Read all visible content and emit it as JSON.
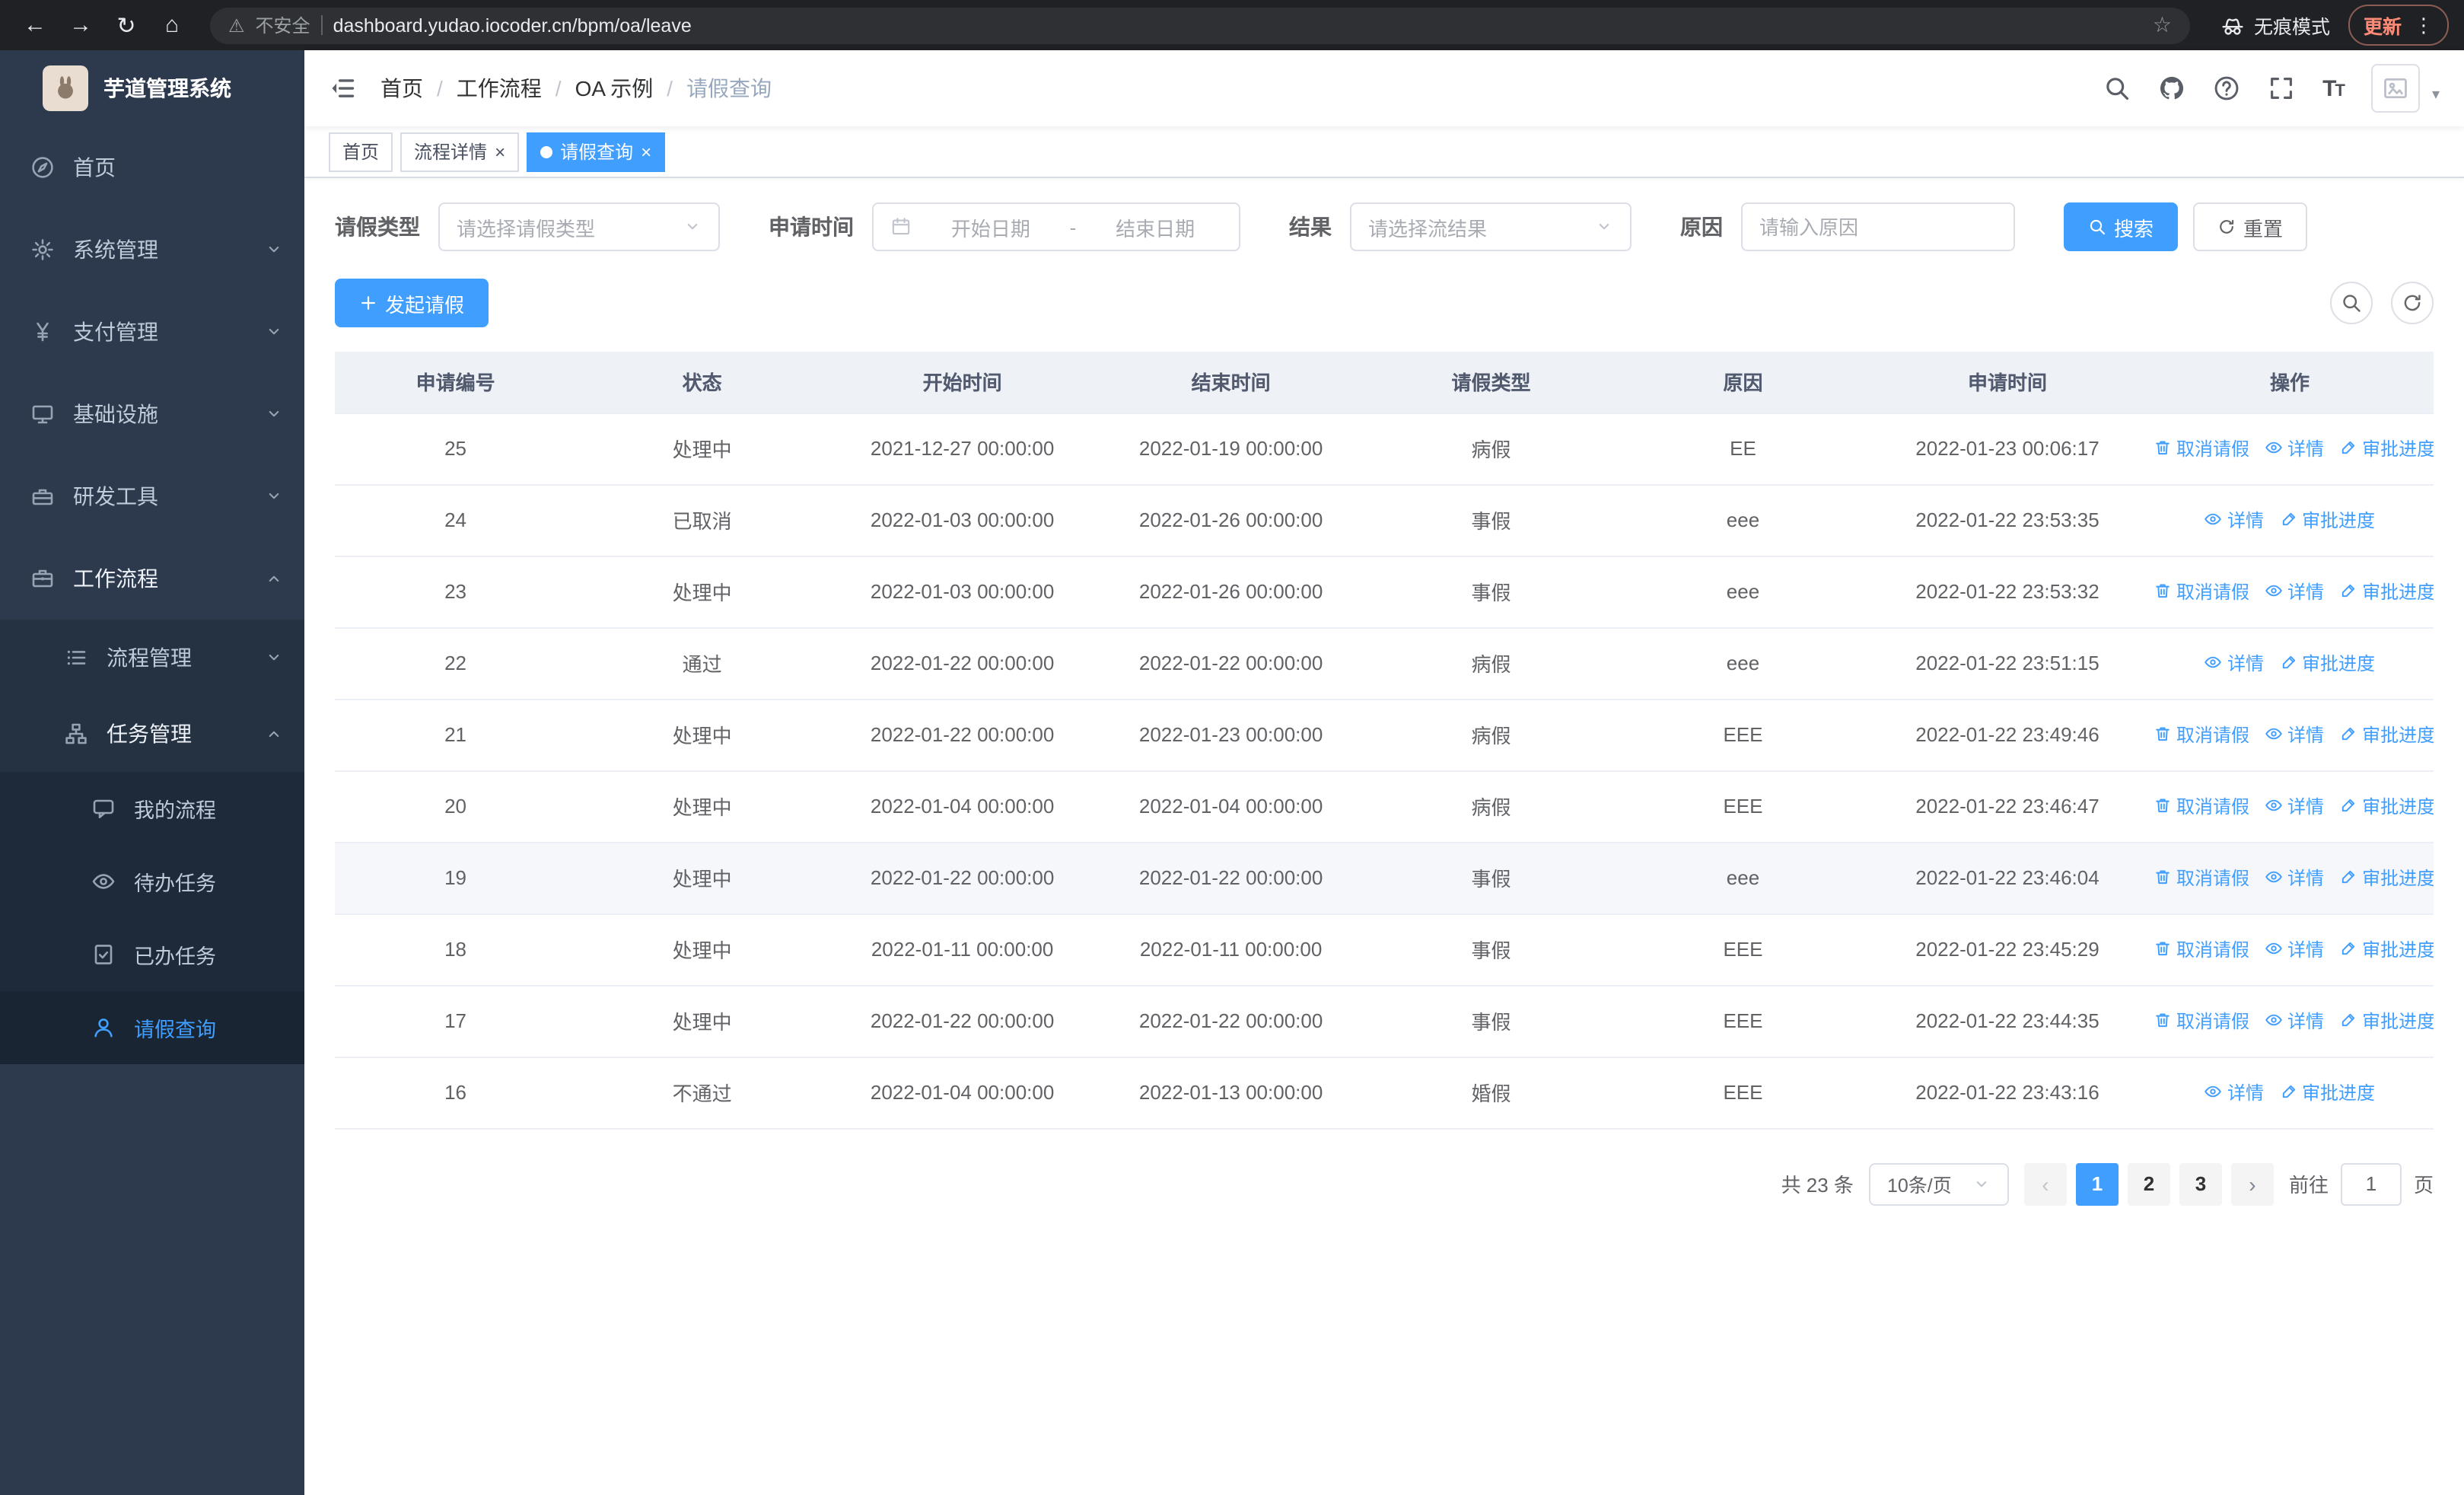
{
  "browser": {
    "security_label": "不安全",
    "url": "dashboard.yudao.iocoder.cn/bpm/oa/leave",
    "incognito_label": "无痕模式",
    "update_label": "更新"
  },
  "sidebar": {
    "logo_title": "芋道管理系统",
    "items": [
      {
        "label": "首页",
        "icon": "compass-icon"
      },
      {
        "label": "系统管理",
        "icon": "gear-icon"
      },
      {
        "label": "支付管理",
        "icon": "yen-icon"
      },
      {
        "label": "基础设施",
        "icon": "monitor-icon"
      },
      {
        "label": "研发工具",
        "icon": "toolbox-icon"
      },
      {
        "label": "工作流程",
        "icon": "briefcase-icon"
      }
    ],
    "workflow_children": [
      {
        "label": "流程管理",
        "icon": "list-icon"
      },
      {
        "label": "任务管理",
        "icon": "hierarchy-icon"
      }
    ],
    "task_children": [
      {
        "label": "我的流程",
        "icon": "chat-icon"
      },
      {
        "label": "待办任务",
        "icon": "eye-icon"
      },
      {
        "label": "已办任务",
        "icon": "doc-check-icon"
      },
      {
        "label": "请假查询",
        "icon": "user-icon"
      }
    ]
  },
  "header": {
    "breadcrumb": [
      "首页",
      "工作流程",
      "OA 示例",
      "请假查询"
    ]
  },
  "tabs": [
    {
      "label": "首页",
      "closable": false,
      "active": false
    },
    {
      "label": "流程详情",
      "closable": true,
      "active": false
    },
    {
      "label": "请假查询",
      "closable": true,
      "active": true
    }
  ],
  "filters": {
    "leave_type_label": "请假类型",
    "leave_type_placeholder": "请选择请假类型",
    "apply_time_label": "申请时间",
    "start_date_placeholder": "开始日期",
    "date_separator": "-",
    "end_date_placeholder": "结束日期",
    "result_label": "结果",
    "result_placeholder": "请选择流结果",
    "reason_label": "原因",
    "reason_placeholder": "请输入原因",
    "search_button": "搜索",
    "reset_button": "重置"
  },
  "toolbar": {
    "create_button": "发起请假"
  },
  "table": {
    "columns": [
      "申请编号",
      "状态",
      "开始时间",
      "结束时间",
      "请假类型",
      "原因",
      "申请时间",
      "操作"
    ],
    "action_labels": {
      "cancel": "取消请假",
      "detail": "详情",
      "progress": "审批进度"
    },
    "rows": [
      {
        "id": "25",
        "status": "处理中",
        "start": "2021-12-27 00:00:00",
        "end": "2022-01-19 00:00:00",
        "type": "病假",
        "reason": "EE",
        "applied": "2022-01-23 00:06:17",
        "cancelable": true,
        "hover": false
      },
      {
        "id": "24",
        "status": "已取消",
        "start": "2022-01-03 00:00:00",
        "end": "2022-01-26 00:00:00",
        "type": "事假",
        "reason": "eee",
        "applied": "2022-01-22 23:53:35",
        "cancelable": false,
        "hover": false
      },
      {
        "id": "23",
        "status": "处理中",
        "start": "2022-01-03 00:00:00",
        "end": "2022-01-26 00:00:00",
        "type": "事假",
        "reason": "eee",
        "applied": "2022-01-22 23:53:32",
        "cancelable": true,
        "hover": false
      },
      {
        "id": "22",
        "status": "通过",
        "start": "2022-01-22 00:00:00",
        "end": "2022-01-22 00:00:00",
        "type": "病假",
        "reason": "eee",
        "applied": "2022-01-22 23:51:15",
        "cancelable": false,
        "hover": false
      },
      {
        "id": "21",
        "status": "处理中",
        "start": "2022-01-22 00:00:00",
        "end": "2022-01-23 00:00:00",
        "type": "病假",
        "reason": "EEE",
        "applied": "2022-01-22 23:49:46",
        "cancelable": true,
        "hover": false
      },
      {
        "id": "20",
        "status": "处理中",
        "start": "2022-01-04 00:00:00",
        "end": "2022-01-04 00:00:00",
        "type": "病假",
        "reason": "EEE",
        "applied": "2022-01-22 23:46:47",
        "cancelable": true,
        "hover": false
      },
      {
        "id": "19",
        "status": "处理中",
        "start": "2022-01-22 00:00:00",
        "end": "2022-01-22 00:00:00",
        "type": "事假",
        "reason": "eee",
        "applied": "2022-01-22 23:46:04",
        "cancelable": true,
        "hover": true
      },
      {
        "id": "18",
        "status": "处理中",
        "start": "2022-01-11 00:00:00",
        "end": "2022-01-11 00:00:00",
        "type": "事假",
        "reason": "EEE",
        "applied": "2022-01-22 23:45:29",
        "cancelable": true,
        "hover": false
      },
      {
        "id": "17",
        "status": "处理中",
        "start": "2022-01-22 00:00:00",
        "end": "2022-01-22 00:00:00",
        "type": "事假",
        "reason": "EEE",
        "applied": "2022-01-22 23:44:35",
        "cancelable": true,
        "hover": false
      },
      {
        "id": "16",
        "status": "不通过",
        "start": "2022-01-04 00:00:00",
        "end": "2022-01-13 00:00:00",
        "type": "婚假",
        "reason": "EEE",
        "applied": "2022-01-22 23:43:16",
        "cancelable": false,
        "hover": false
      }
    ]
  },
  "pagination": {
    "total_text": "共 23 条",
    "page_size": "10条/页",
    "pages": [
      "1",
      "2",
      "3"
    ],
    "active_page": "1",
    "goto_label": "前往",
    "goto_value": "1",
    "page_unit": "页"
  },
  "colors": {
    "accent": "#409eff",
    "sidebar_bg": "#2d3a4d",
    "chrome_bg": "#202124"
  }
}
